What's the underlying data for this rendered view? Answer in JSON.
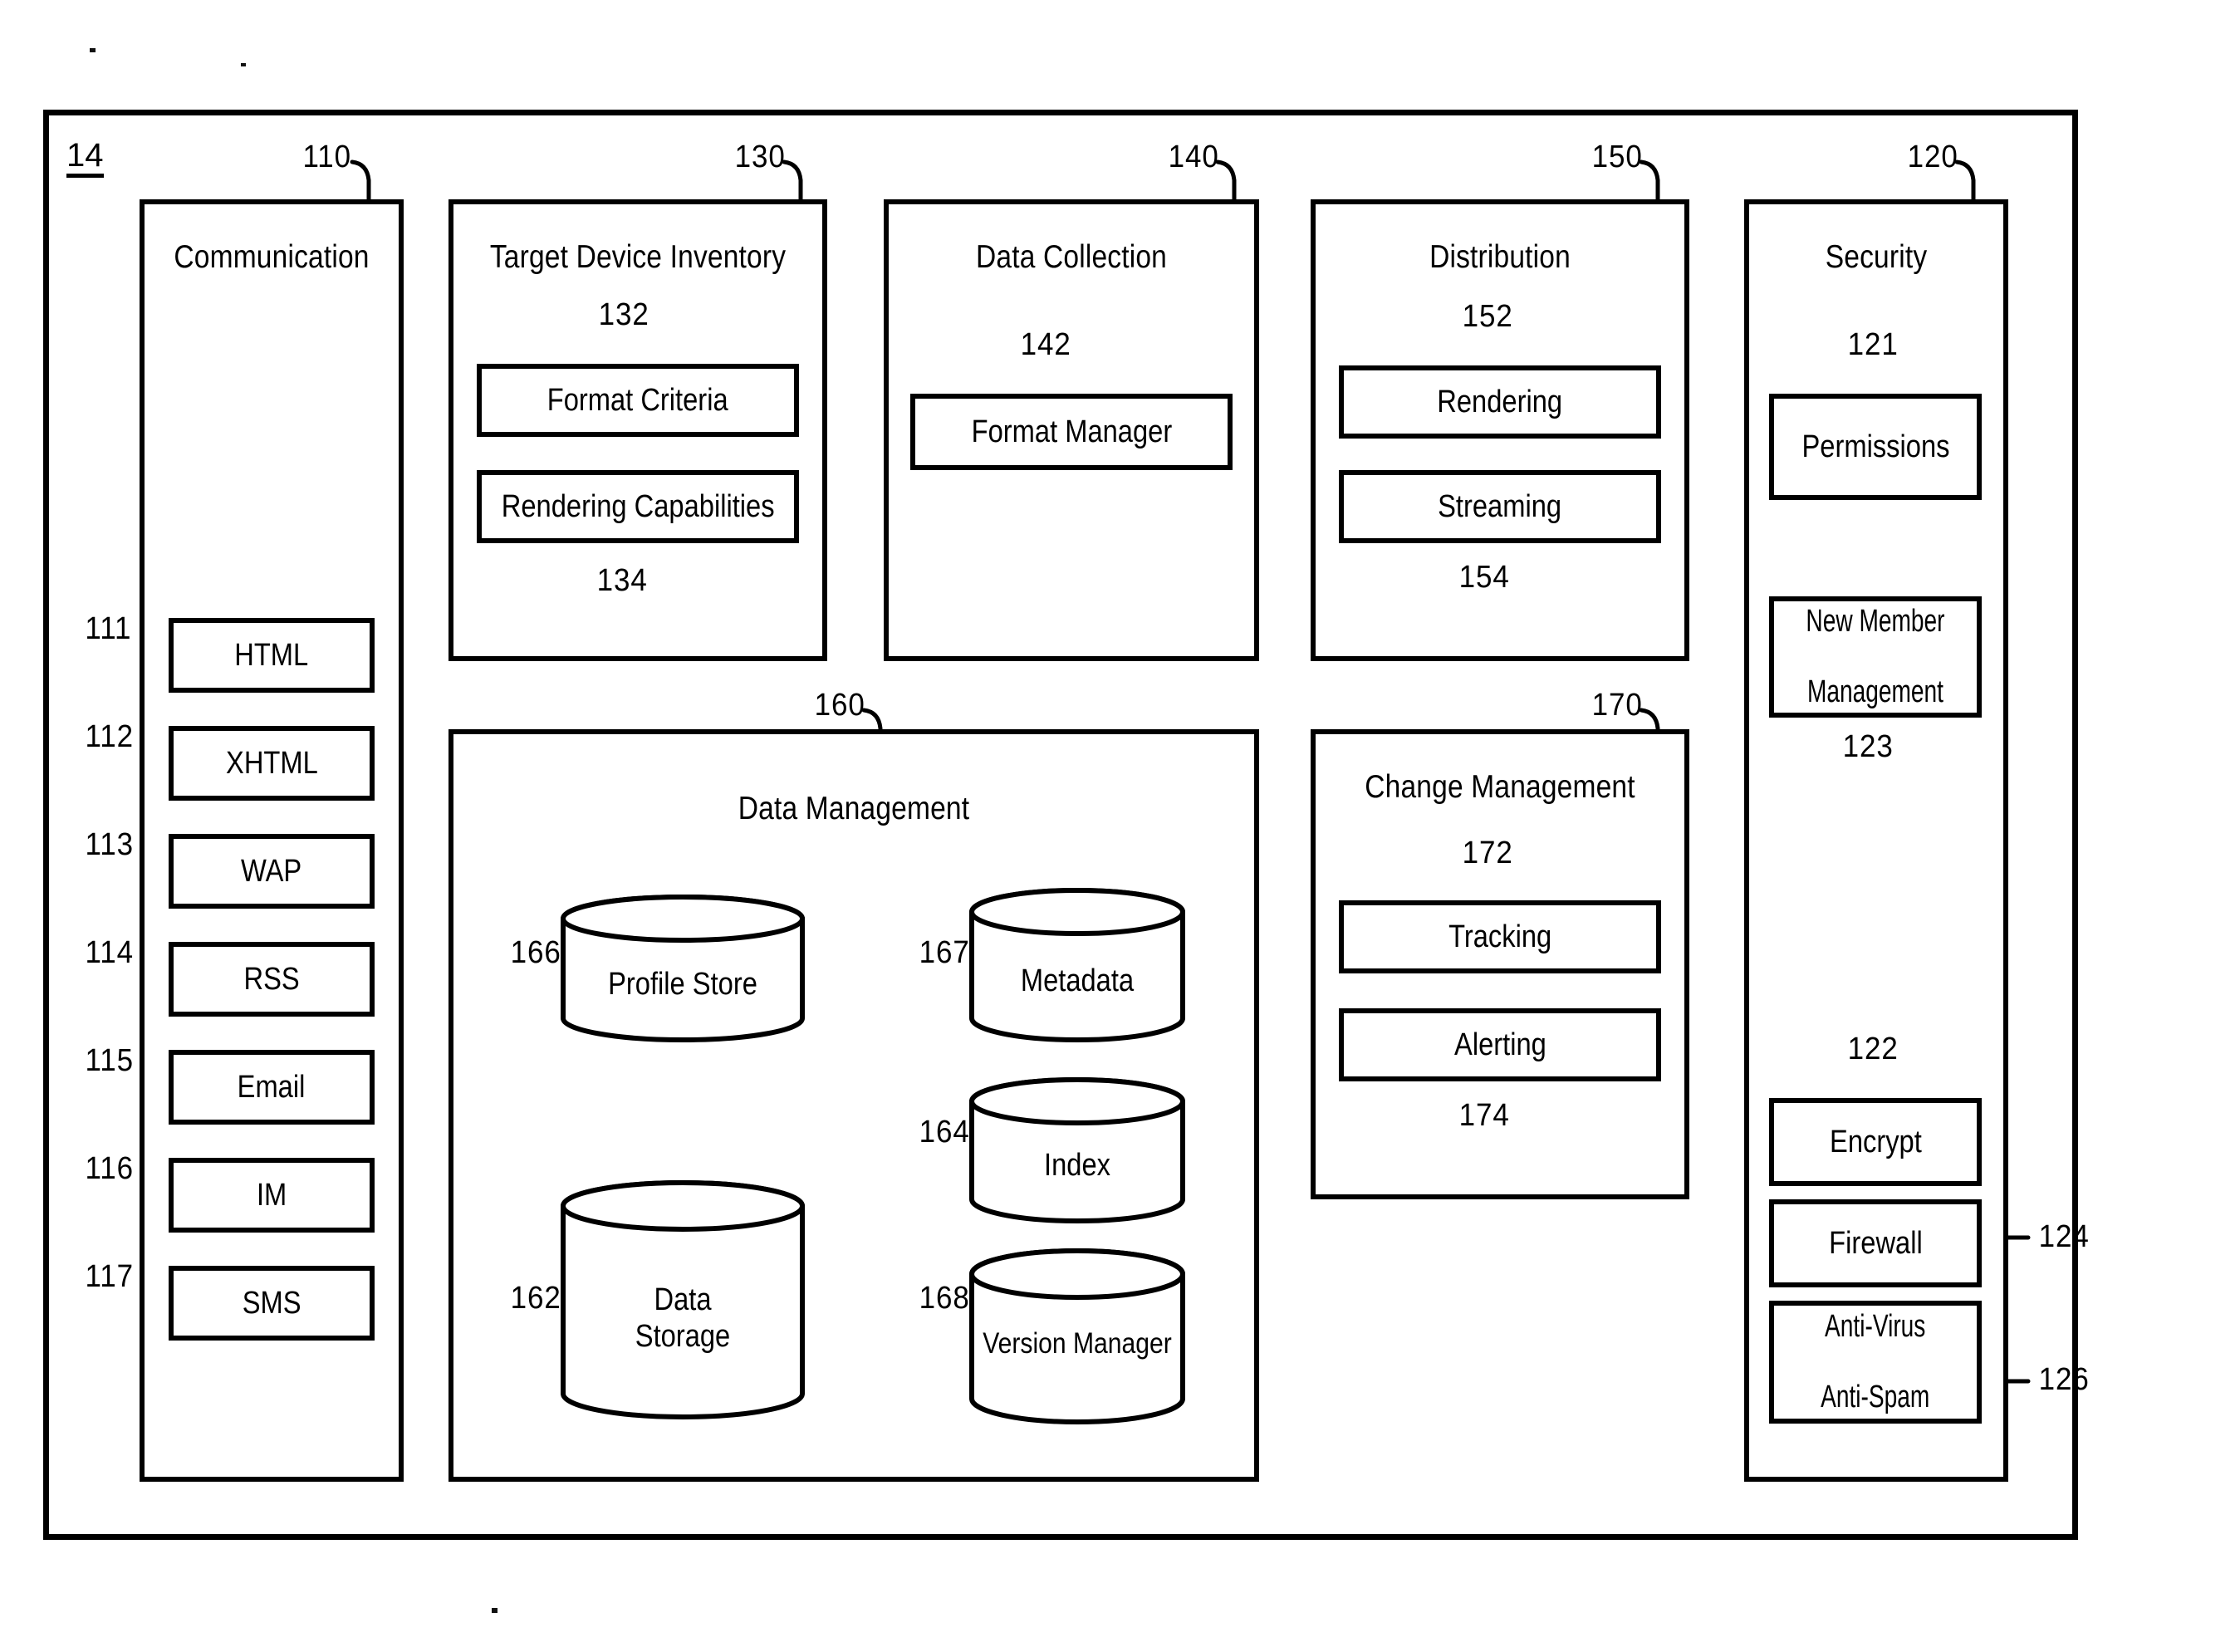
{
  "figure": {
    "figure_ref": "14",
    "modules": [
      {
        "id": "communication",
        "ref": "110",
        "title": "Communication",
        "items": [
          {
            "ref": "111",
            "label": "HTML"
          },
          {
            "ref": "112",
            "label": "XHTML"
          },
          {
            "ref": "113",
            "label": "WAP"
          },
          {
            "ref": "114",
            "label": "RSS"
          },
          {
            "ref": "115",
            "label": "Email"
          },
          {
            "ref": "116",
            "label": "IM"
          },
          {
            "ref": "117",
            "label": "SMS"
          }
        ]
      },
      {
        "id": "target-device-inventory",
        "ref": "130",
        "title": "Target Device Inventory",
        "items": [
          {
            "ref": "132",
            "label": "Format Criteria"
          },
          {
            "ref": "134",
            "label": "Rendering Capabilities"
          }
        ]
      },
      {
        "id": "data-collection",
        "ref": "140",
        "title": "Data Collection",
        "items": [
          {
            "ref": "142",
            "label": "Format Manager"
          }
        ]
      },
      {
        "id": "distribution",
        "ref": "150",
        "title": "Distribution",
        "items": [
          {
            "ref": "152",
            "label": "Rendering"
          },
          {
            "ref": "154",
            "label": "Streaming"
          }
        ]
      },
      {
        "id": "security",
        "ref": "120",
        "title": "Security",
        "items": [
          {
            "ref": "121",
            "label": "Permissions"
          },
          {
            "ref": "123",
            "label": "New Member Management"
          },
          {
            "ref": "122",
            "label": "Encrypt"
          },
          {
            "ref": "124",
            "label": "Firewall"
          },
          {
            "ref": "126",
            "label": "Anti-Virus Anti-Spam"
          }
        ]
      },
      {
        "id": "data-management",
        "ref": "160",
        "title": "Data Management",
        "items": [
          {
            "ref": "166",
            "label": "Profile Store"
          },
          {
            "ref": "167",
            "label": "Metadata"
          },
          {
            "ref": "164",
            "label": "Index"
          },
          {
            "ref": "162",
            "label": "Data Storage"
          },
          {
            "ref": "168",
            "label": "Version Manager"
          }
        ]
      },
      {
        "id": "change-management",
        "ref": "170",
        "title": "Change Management",
        "items": [
          {
            "ref": "172",
            "label": "Tracking"
          },
          {
            "ref": "174",
            "label": "Alerting"
          }
        ]
      }
    ]
  },
  "communication": {
    "ref": "110",
    "title": "Communication",
    "items": [
      {
        "ref": "111",
        "label": "HTML"
      },
      {
        "ref": "112",
        "label": "XHTML"
      },
      {
        "ref": "113",
        "label": "WAP"
      },
      {
        "ref": "114",
        "label": "RSS"
      },
      {
        "ref": "115",
        "label": "Email"
      },
      {
        "ref": "116",
        "label": "IM"
      },
      {
        "ref": "117",
        "label": "SMS"
      }
    ]
  },
  "target_device_inventory": {
    "ref": "130",
    "title": "Target Device Inventory",
    "format_criteria": {
      "ref": "132",
      "label": "Format Criteria"
    },
    "rendering_capabilities": {
      "ref": "134",
      "label": "Rendering Capabilities"
    }
  },
  "data_collection": {
    "ref": "140",
    "title": "Data Collection",
    "format_manager": {
      "ref": "142",
      "label": "Format Manager"
    }
  },
  "distribution": {
    "ref": "150",
    "title": "Distribution",
    "rendering": {
      "ref": "152",
      "label": "Rendering"
    },
    "streaming": {
      "ref": "154",
      "label": "Streaming"
    }
  },
  "security": {
    "ref": "120",
    "title": "Security",
    "permissions": {
      "ref": "121",
      "label": "Permissions"
    },
    "new_member_management": {
      "ref": "123",
      "label_line1": "New Member",
      "label_line2": "Management"
    },
    "encrypt": {
      "ref": "122",
      "label": "Encrypt"
    },
    "firewall": {
      "ref": "124",
      "label": "Firewall"
    },
    "antivirus": {
      "ref": "126",
      "label_line1": "Anti-Virus",
      "label_line2": "Anti-Spam"
    }
  },
  "data_management": {
    "ref": "160",
    "title": "Data Management",
    "profile_store": {
      "ref": "166",
      "label": "Profile Store"
    },
    "metadata": {
      "ref": "167",
      "label": "Metadata"
    },
    "index": {
      "ref": "164",
      "label": "Index"
    },
    "data_storage": {
      "ref": "162",
      "label_line1": "Data",
      "label_line2": "Storage"
    },
    "version_manager": {
      "ref": "168",
      "label": "Version Manager"
    }
  },
  "change_management": {
    "ref": "170",
    "title": "Change Management",
    "tracking": {
      "ref": "172",
      "label": "Tracking"
    },
    "alerting": {
      "ref": "174",
      "label": "Alerting"
    }
  },
  "colors": {
    "ink": "#000000",
    "paper": "#ffffff"
  }
}
